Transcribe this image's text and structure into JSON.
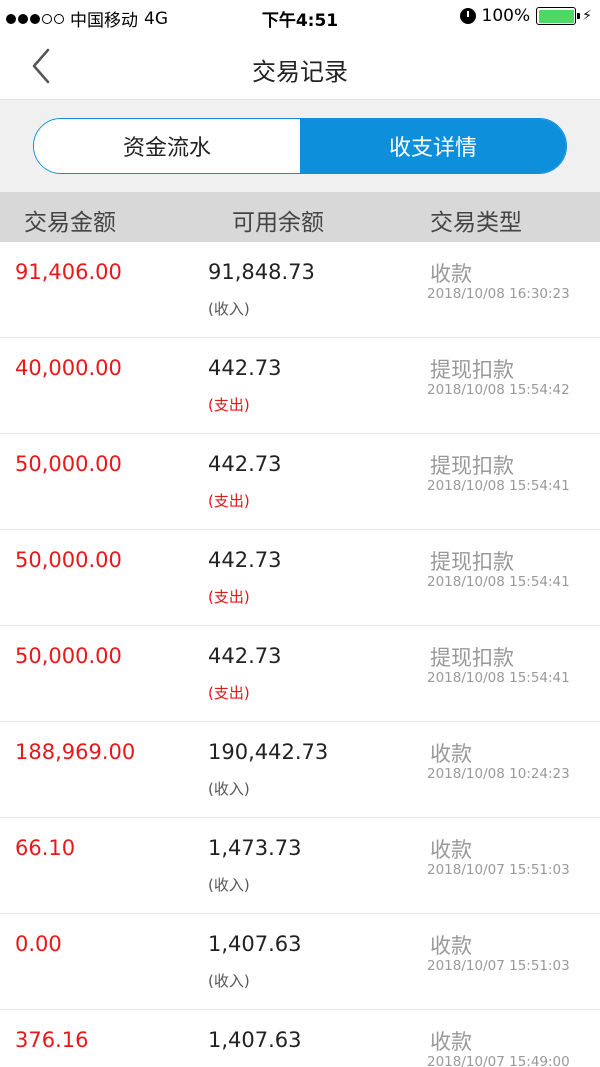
{
  "status_bar": {
    "carrier": "中国移动",
    "network": "4G",
    "time": "下午4:51",
    "battery_percent": "100%",
    "signal_strength": 3,
    "battery_color": "#4cd964"
  },
  "nav": {
    "title": "交易记录",
    "back_icon": "chevron-left-icon"
  },
  "tabs": [
    {
      "label": "资金流水",
      "active": false
    },
    {
      "label": "收支详情",
      "active": true
    }
  ],
  "table": {
    "headers": [
      "交易金额",
      "可用余额",
      "交易类型"
    ],
    "rows": [
      {
        "amount": "91,406.00",
        "balance": "91,848.73",
        "direction": "(收入)",
        "kind": "income",
        "type": "收款",
        "datetime": "2018/10/08 16:30:23"
      },
      {
        "amount": "40,000.00",
        "balance": "442.73",
        "direction": "(支出)",
        "kind": "expense",
        "type": "提现扣款",
        "datetime": "2018/10/08 15:54:42"
      },
      {
        "amount": "50,000.00",
        "balance": "442.73",
        "direction": "(支出)",
        "kind": "expense",
        "type": "提现扣款",
        "datetime": "2018/10/08 15:54:41"
      },
      {
        "amount": "50,000.00",
        "balance": "442.73",
        "direction": "(支出)",
        "kind": "expense",
        "type": "提现扣款",
        "datetime": "2018/10/08 15:54:41"
      },
      {
        "amount": "50,000.00",
        "balance": "442.73",
        "direction": "(支出)",
        "kind": "expense",
        "type": "提现扣款",
        "datetime": "2018/10/08 15:54:41"
      },
      {
        "amount": "188,969.00",
        "balance": "190,442.73",
        "direction": "(收入)",
        "kind": "income",
        "type": "收款",
        "datetime": "2018/10/08 10:24:23"
      },
      {
        "amount": "66.10",
        "balance": "1,473.73",
        "direction": "(收入)",
        "kind": "income",
        "type": "收款",
        "datetime": "2018/10/07 15:51:03"
      },
      {
        "amount": "0.00",
        "balance": "1,407.63",
        "direction": "(收入)",
        "kind": "income",
        "type": "收款",
        "datetime": "2018/10/07 15:51:03"
      },
      {
        "amount": "376.16",
        "balance": "1,407.63",
        "direction": "",
        "kind": "income",
        "type": "收款",
        "datetime": "2018/10/07 15:49:00"
      }
    ]
  },
  "colors": {
    "accent": "#0d8fdc",
    "amount_red": "#e8171a",
    "muted_gray": "#999999",
    "header_bg": "#d8d8d8"
  }
}
